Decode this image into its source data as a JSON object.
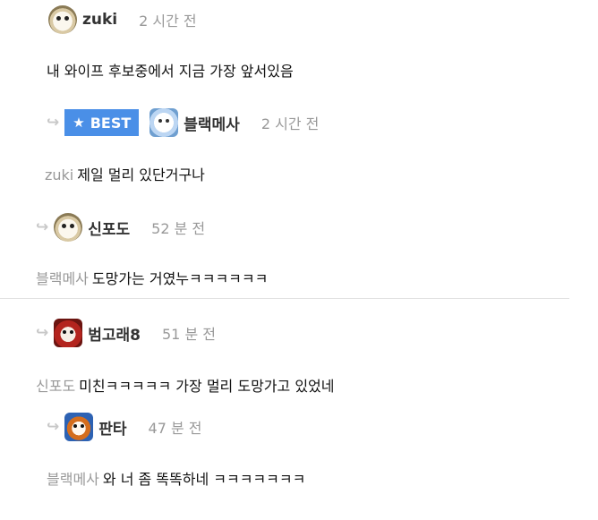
{
  "comments": [
    {
      "nickname": "zuki",
      "time": "2 시간 전",
      "mention": "",
      "text": "내 와이프 후보중에서 지금 가장 앞서있음"
    },
    {
      "badge_label": "BEST",
      "nickname": "블랙메사",
      "time": "2 시간 전",
      "mention": "zuki",
      "text": "제일 멀리 있단거구나"
    },
    {
      "nickname": "신포도",
      "time": "52 분 전",
      "mention": "블랙메사",
      "text": "도망가는 거였누ㅋㅋㅋㅋㅋㅋ"
    },
    {
      "nickname": "범고래8",
      "time": "51 분 전",
      "mention": "신포도",
      "text": "미친ㅋㅋㅋㅋㅋ 가장 멀리 도망가고 있었네"
    },
    {
      "nickname": "판타",
      "time": "47 분 전",
      "mention": "블랙메사",
      "text": "와 너 좀 똑똑하네 ㅋㅋㅋㅋㅋㅋㅋ"
    }
  ],
  "icons": {
    "reply": "reply-arrow-icon",
    "best": "star-icon"
  },
  "colors": {
    "best_badge": "#4a8fe7",
    "mention": "#999999",
    "time": "#999999"
  }
}
